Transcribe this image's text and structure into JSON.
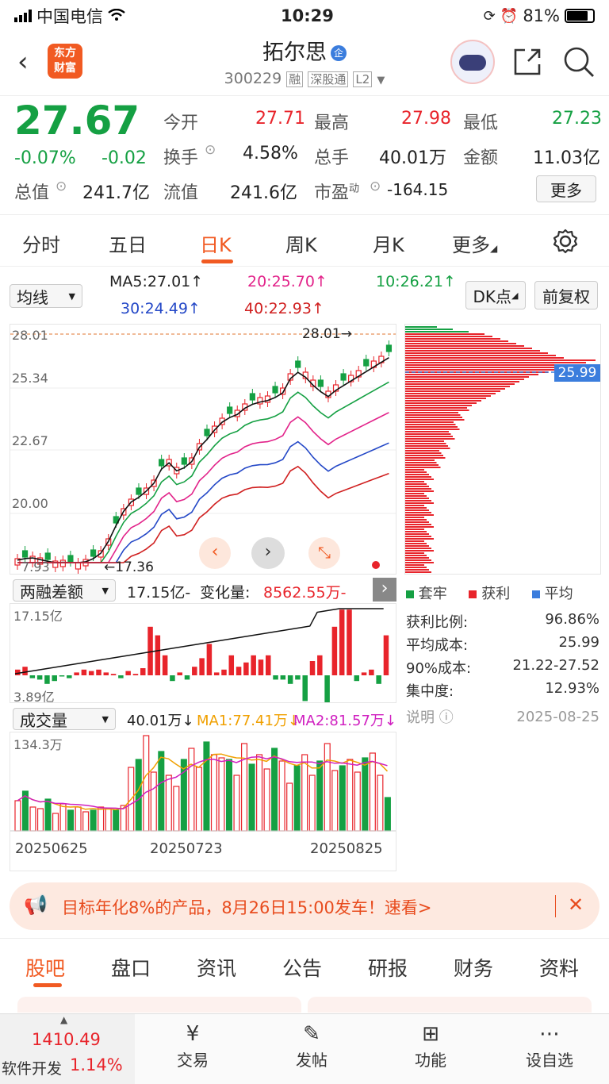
{
  "status_bar": {
    "carrier": "中国电信",
    "time": "10:29",
    "battery": "81%"
  },
  "header": {
    "logo_line1": "东方",
    "logo_line2": "财富",
    "title": "拓尔思",
    "badge": "企",
    "code": "300229",
    "tag1": "融",
    "tag2": "深股通",
    "tag3": "L2"
  },
  "quote": {
    "price": "27.67",
    "change_pct": "-0.07%",
    "change": "-0.02",
    "open_label": "今开",
    "open": "27.71",
    "high_label": "最高",
    "high": "27.98",
    "low_label": "最低",
    "low": "27.23",
    "turnover_label": "换手",
    "turnover": "4.58%",
    "volume_label": "总手",
    "volume": "40.01万",
    "amount_label": "金额",
    "amount": "11.03亿",
    "mcap_label": "总值",
    "mcap": "241.7亿",
    "float_label": "流值",
    "float": "241.6亿",
    "pe_label": "市盈",
    "pe_sup": "动",
    "pe": "-164.15",
    "more": "更多"
  },
  "tabs": [
    "分时",
    "五日",
    "日K",
    "周K",
    "月K",
    "更多"
  ],
  "ma_bar": {
    "selector": "均线",
    "ma5": "MA5:27.01↑",
    "ma20": "20:25.70↑",
    "ma10": "10:26.21↑",
    "ma30": "30:24.49↑",
    "ma40": "40:22.93↑",
    "dk": "DK点",
    "fq": "前复权"
  },
  "kline": {
    "y_labels": [
      "28.01",
      "25.34",
      "22.67",
      "20.00"
    ],
    "max_label": "28.01→",
    "min_label": "←17.36",
    "partial_label": "7.93"
  },
  "chip": {
    "avg_price": "25.99",
    "legend": [
      "套牢",
      "获利",
      "平均"
    ],
    "rows": [
      {
        "k": "获利比例:",
        "v": "96.86%"
      },
      {
        "k": "平均成本:",
        "v": "25.99"
      },
      {
        "k": "90%成本:",
        "v": "21.22-27.52"
      },
      {
        "k": "集中度:",
        "v": "12.93%"
      }
    ],
    "note": "说明",
    "date": "2025-08-25"
  },
  "margin": {
    "selector": "两融差额",
    "value": "17.15亿-",
    "change_label": "变化量:",
    "change": "8562.55万-",
    "top": "17.15亿",
    "bottom": "3.89亿"
  },
  "volume": {
    "selector": "成交量",
    "value": "40.01万↓",
    "ma1": "MA1:77.41万↓",
    "ma2": "MA2:81.57万↓",
    "top": "134.3万",
    "dates": [
      "20250625",
      "20250723",
      "20250825"
    ]
  },
  "banner": {
    "text": "目标年化8%的产品，8月26日15:00发车！速看>"
  },
  "sub_tabs": [
    "股吧",
    "盘口",
    "资讯",
    "公告",
    "研报",
    "财务",
    "资料"
  ],
  "bottom_nav": {
    "index_value": "1410.49",
    "index_name": "软件开发",
    "index_pct": "1.14%",
    "items": [
      "交易",
      "发帖",
      "功能",
      "设自选"
    ]
  },
  "colors": {
    "up": "#e8242b",
    "down": "#15a043",
    "accent": "#f15a22"
  }
}
